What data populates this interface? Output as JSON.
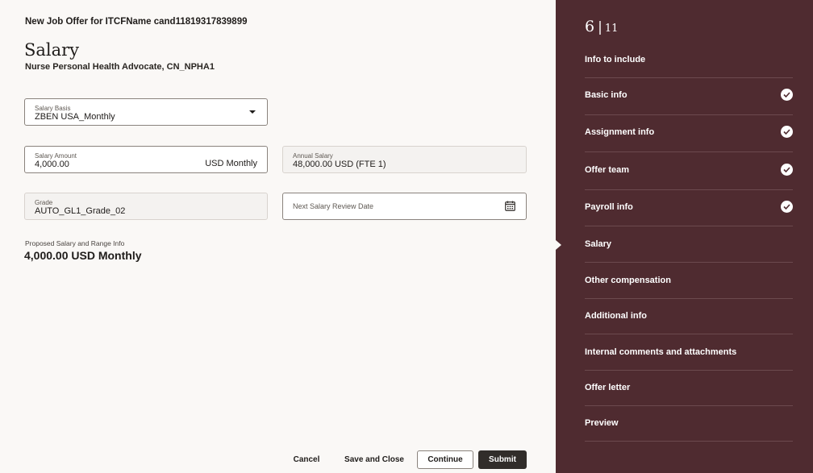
{
  "header": {
    "offer_title": "New Job Offer for ITCFName cand11819317839899",
    "page_title": "Salary",
    "subtitle": "Nurse Personal Health Advocate, CN_NPHA1"
  },
  "form": {
    "salary_basis": {
      "label": "Salary Basis",
      "value": "ZBEN USA_Monthly"
    },
    "salary_amount": {
      "label": "Salary Amount",
      "value": "4,000.00",
      "suffix": "USD Monthly"
    },
    "annual_salary": {
      "label": "Annual Salary",
      "value": "48,000.00 USD (FTE 1)"
    },
    "grade": {
      "label": "Grade",
      "value": "AUTO_GL1_Grade_02"
    },
    "next_review_date": {
      "placeholder": "Next Salary Review Date",
      "icon": "calendar-icon"
    },
    "proposed": {
      "label": "Proposed Salary and Range Info",
      "value": "4,000.00 USD Monthly"
    }
  },
  "buttons": {
    "cancel": "Cancel",
    "save_close": "Save and Close",
    "continue": "Continue",
    "submit": "Submit"
  },
  "train": {
    "current_step": "6",
    "total_steps": "11",
    "items": [
      {
        "label": "Info to include",
        "complete": false
      },
      {
        "label": "Basic info",
        "complete": true
      },
      {
        "label": "Assignment info",
        "complete": true
      },
      {
        "label": "Offer team",
        "complete": true
      },
      {
        "label": "Payroll info",
        "complete": true
      },
      {
        "label": "Salary",
        "complete": false,
        "current": true
      },
      {
        "label": "Other compensation",
        "complete": false
      },
      {
        "label": "Additional info",
        "complete": false
      },
      {
        "label": "Internal comments and attachments",
        "complete": false
      },
      {
        "label": "Offer letter",
        "complete": false
      },
      {
        "label": "Preview",
        "complete": false
      }
    ]
  },
  "colors": {
    "sidebar_bg": "#4f2b30",
    "page_bg": "#faf8f6",
    "primary_button": "#312d2a"
  }
}
